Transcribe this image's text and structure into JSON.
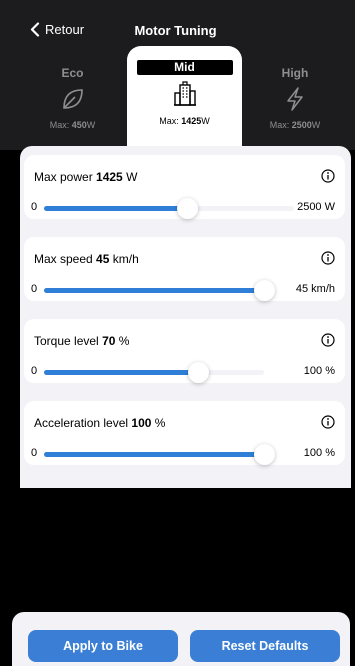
{
  "header": {
    "back_label": "Retour",
    "title": "Motor Tuning"
  },
  "modes": [
    {
      "name": "Eco",
      "max_prefix": "Max: ",
      "max_value": "450",
      "max_unit": "W",
      "icon": "leaf-icon",
      "selected": false
    },
    {
      "name": "Mid",
      "max_prefix": "Max: ",
      "max_value": "1425",
      "max_unit": "W",
      "icon": "city-icon",
      "selected": true
    },
    {
      "name": "High",
      "max_prefix": "Max: ",
      "max_value": "2500",
      "max_unit": "W",
      "icon": "lightning-icon",
      "selected": false
    }
  ],
  "sliders": [
    {
      "label": "Max power",
      "value": "1425",
      "unit": "W",
      "min": "0",
      "max": "2500 W",
      "fraction": 0.57
    },
    {
      "label": "Max speed",
      "value": "45",
      "unit": "km/h",
      "min": "0",
      "max": "45 km/h",
      "fraction": 1.0
    },
    {
      "label": "Torque level",
      "value": "70",
      "unit": "%",
      "min": "0",
      "max": "100 %",
      "fraction": 0.7
    },
    {
      "label": "Acceleration level",
      "value": "100",
      "unit": "%",
      "min": "0",
      "max": "100 %",
      "fraction": 1.0
    }
  ],
  "footer": {
    "apply_label": "Apply to Bike",
    "reset_label": "Reset Defaults"
  },
  "colors": {
    "accent": "#3a7fd5",
    "slider_fill": "#2f7fd8",
    "header_bg": "#1c1c1e",
    "card_bg": "#f2f2f7"
  }
}
